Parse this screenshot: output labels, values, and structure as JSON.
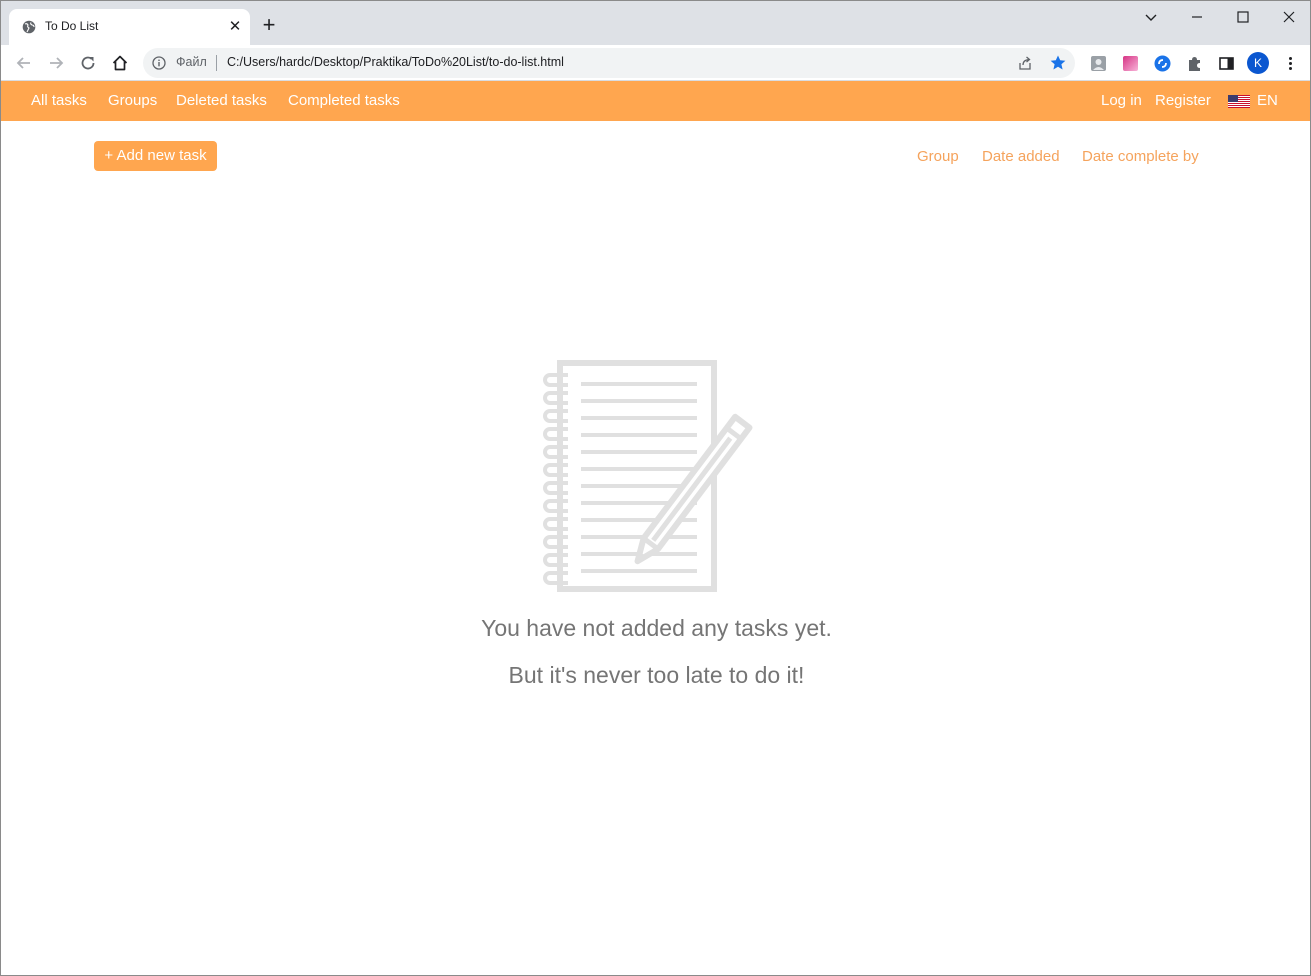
{
  "browser": {
    "tab_title": "To Do List",
    "tab_close": "✕",
    "new_tab": "+",
    "scheme_label": "Файл",
    "url": "C:/Users/hardc/Desktop/Praktika/ToDo%20List/to-do-list.html",
    "profile_initial": "K",
    "icons": [
      "globe-icon",
      "back-icon",
      "forward-icon",
      "reload-icon",
      "home-icon",
      "info-icon",
      "share-icon",
      "star-icon",
      "puzzle-icon",
      "side-panel-icon",
      "kebab-menu-icon"
    ]
  },
  "nav": {
    "links": [
      "All tasks",
      "Groups",
      "Deleted tasks",
      "Completed tasks"
    ],
    "login": "Log in",
    "register": "Register",
    "language": "EN"
  },
  "toolbar": {
    "add_task": "+ Add new task",
    "sort": [
      "Group",
      "Date added",
      "Date complete by"
    ]
  },
  "empty_state": {
    "line1": "You have not added any tasks yet.",
    "line2": "But it's never too late to do it!"
  },
  "colors": {
    "accent": "#ffa64f",
    "sort_link": "#f5a35c",
    "empty_text": "#757575",
    "illustration": "#e0e0e0"
  }
}
